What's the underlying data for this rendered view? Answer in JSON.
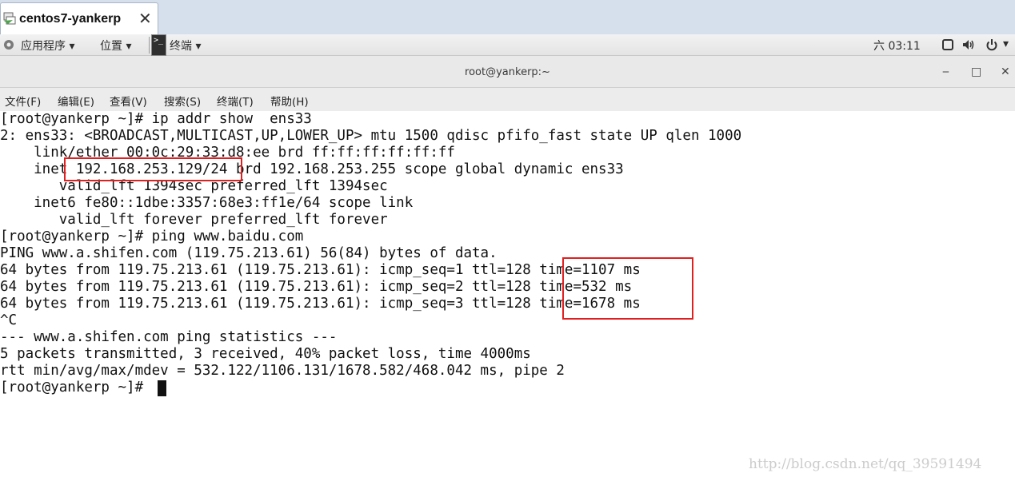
{
  "vm_tab": {
    "title": "centos7-yankerp",
    "close_glyph": "✕"
  },
  "topbar": {
    "apps_label": "应用程序 ▾",
    "places_label": "位置 ▾",
    "terminal_glyph": ">_",
    "terminal_label": "终端 ▾",
    "clock": "六 03:11",
    "status_icons": [
      "display-icon",
      "volume-icon",
      "power-icon"
    ]
  },
  "window": {
    "title": "root@yankerp:~",
    "minimize": "‒",
    "maximize": "□",
    "close": "✕"
  },
  "menubar": {
    "items": [
      "文件(F)",
      "编辑(E)",
      "查看(V)",
      "搜索(S)",
      "终端(T)",
      "帮助(H)"
    ]
  },
  "terminal": {
    "lines": [
      "[root@yankerp ~]# ip addr show  ens33",
      "2: ens33: <BROADCAST,MULTICAST,UP,LOWER_UP> mtu 1500 qdisc pfifo_fast state UP qlen 1000",
      "    link/ether 00:0c:29:33:d8:ee brd ff:ff:ff:ff:ff:ff",
      "    inet 192.168.253.129/24 brd 192.168.253.255 scope global dynamic ens33",
      "       valid_lft 1394sec preferred_lft 1394sec",
      "    inet6 fe80::1dbe:3357:68e3:ff1e/64 scope link",
      "       valid_lft forever preferred_lft forever",
      "[root@yankerp ~]# ping www.baidu.com",
      "PING www.a.shifen.com (119.75.213.61) 56(84) bytes of data.",
      "64 bytes from 119.75.213.61 (119.75.213.61): icmp_seq=1 ttl=128 time=1107 ms",
      "64 bytes from 119.75.213.61 (119.75.213.61): icmp_seq=2 ttl=128 time=532 ms",
      "64 bytes from 119.75.213.61 (119.75.213.61): icmp_seq=3 ttl=128 time=1678 ms",
      "^C",
      "--- www.a.shifen.com ping statistics ---",
      "5 packets transmitted, 3 received, 40% packet loss, time 4000ms",
      "rtt min/avg/max/mdev = 532.122/1106.131/1678.582/468.042 ms, pipe 2",
      "[root@yankerp ~]# "
    ]
  },
  "watermark": "http://blog.csdn.net/qq_39591494",
  "colors": {
    "highlight": "#e02020",
    "tabbar": "#d6dfec",
    "terminal_bg": "#ffffff",
    "terminal_fg": "#111111"
  }
}
